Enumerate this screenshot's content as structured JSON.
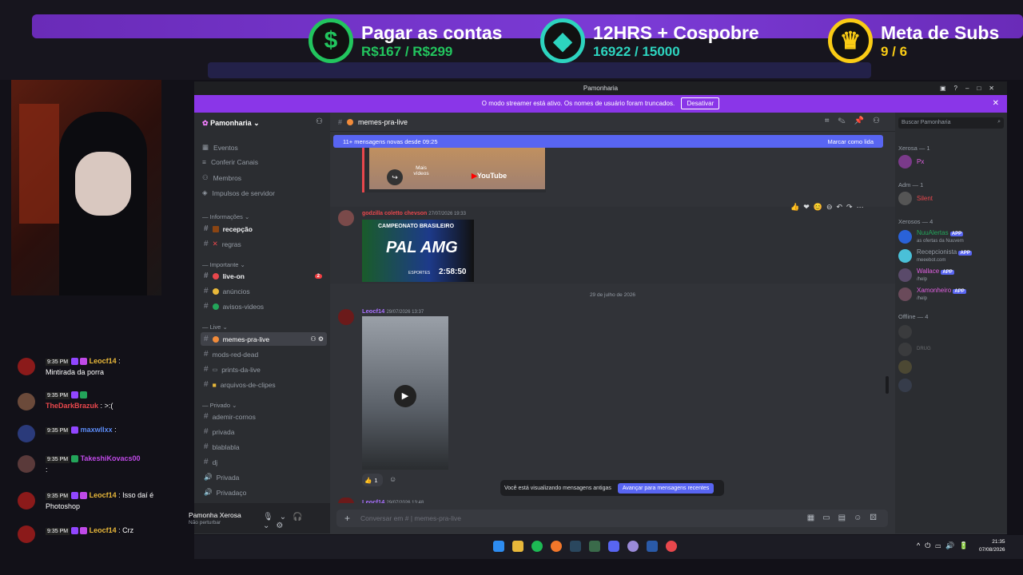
{
  "goals": [
    {
      "title": "Pagar as contas",
      "value": "R$167 / R$299",
      "icon": "$",
      "color": "#22c55e"
    },
    {
      "title": "12HRS + Cospobre",
      "value": "16922 / 15000",
      "icon": "◆",
      "color": "#2dd4bf"
    },
    {
      "title": "Meta de Subs",
      "value": "9 / 6",
      "icon": "♛",
      "color": "#facc15"
    }
  ],
  "chat": [
    {
      "time": "9:35 PM",
      "user": "Leocf14",
      "sep": ":",
      "text": "Mintirada da porra",
      "color": "#e8b83a"
    },
    {
      "time": "9:35 PM",
      "user": "TheDarkBrazuk",
      "sep": ":",
      "text": ">:(",
      "color": "#e8474c"
    },
    {
      "time": "9:35 PM",
      "user": "maxwllxx",
      "sep": ":",
      "text": "",
      "color": "#5b8bf5"
    },
    {
      "time": "9:35 PM",
      "user": "TakeshiKovacs00",
      "sep": ":",
      "text": "",
      "color": "#c04ae8"
    },
    {
      "time": "9:35 PM",
      "user": "Leocf14",
      "sep": ":",
      "text": "Isso daí é Photoshop",
      "color": "#e8b83a"
    },
    {
      "time": "9:35 PM",
      "user": "Leocf14",
      "sep": ":",
      "text": "Crz",
      "color": "#e8b83a"
    }
  ],
  "window": {
    "title": "Pamonharia"
  },
  "streamer": {
    "message": "O modo streamer está ativo. Os nomes de usuário foram truncados.",
    "button": "Desativar"
  },
  "server": {
    "name": "Pamonharia"
  },
  "menu": [
    "Eventos",
    "Conferir Canais",
    "Membros",
    "Impulsos de servidor"
  ],
  "categories": {
    "info": "Informações",
    "important": "Importante",
    "live": "Live",
    "private": "Privado"
  },
  "channels": {
    "recepcao": "recepção",
    "regras": "regras",
    "liveon": "live-on",
    "anuncios": "anúncios",
    "avisos": "avisos-videos",
    "memes": "memes-pra-live",
    "modsred": "mods-red-dead",
    "prints": "prints-da-live",
    "arquivos": "arquivos-de-clipes",
    "ademir": "ademir-cornos",
    "privada": "privada",
    "blabla": "blablabla",
    "dj": "dj",
    "privada2": "Privada",
    "privadaco": "Privadaço"
  },
  "badge_liveon": "2",
  "user": {
    "name": "Pamonha Xerosa",
    "status": "Não perturbar"
  },
  "channel_header": {
    "name": "memes-pra-live"
  },
  "newmsgs": {
    "text": "11+ mensagens novas desde 09:25",
    "action": "Marcar como lida"
  },
  "messages": [
    {
      "author": "godzilla coletto chevson",
      "time": "27/07/2026 19:33",
      "color": "#e8474c"
    },
    {
      "author": "Leocf14",
      "time": "29/07/2026 13:37",
      "color": "#a970ff"
    },
    {
      "author": "Leocf14",
      "time": "29/07/2026 13:48",
      "color": "#a970ff"
    }
  ],
  "date_divider": "29 de julho de 2026",
  "youtube_embed": {
    "more": "Mais vídeos",
    "brand": "YouTube"
  },
  "match_image": {
    "title": "CAMPEONATO BRASILEIRO",
    "teams": "PAL AMG",
    "time": "2:58:50",
    "channel": "ESPORTES"
  },
  "reaction_count": "1",
  "old_msgs": {
    "text": "Você está visualizando mensagens antigas",
    "button": "Avançar para mensagens recentes"
  },
  "composer": {
    "placeholder": "Conversar em #  | memes-pra-live"
  },
  "search": {
    "placeholder": "Buscar Pamonharia"
  },
  "member_groups": [
    {
      "label": "Xerosa — 1"
    },
    {
      "label": "Adm — 1"
    },
    {
      "label": "Xerosos — 4"
    },
    {
      "label": "Offline — 4"
    }
  ],
  "members": [
    {
      "name": "Px",
      "color": "#e060e0"
    },
    {
      "name": "Silent",
      "color": "#e8474c"
    },
    {
      "name": "NuuAlertas",
      "color": "#23a55a",
      "sub": "as ofertas da Nuuvem",
      "app": "APP"
    },
    {
      "name": "Recepcionista",
      "color": "#949ba4",
      "sub": "meeebot.com",
      "app": "APP"
    },
    {
      "name": "Wallace",
      "color": "#e060e0",
      "sub": "/help",
      "app": "APP"
    },
    {
      "name": "Xamonheiro",
      "color": "#e060e0",
      "sub": "/help",
      "app": "APP"
    }
  ],
  "offline_hint": "DRUG",
  "clock": {
    "time": "21:35",
    "date": "07/08/2026"
  }
}
